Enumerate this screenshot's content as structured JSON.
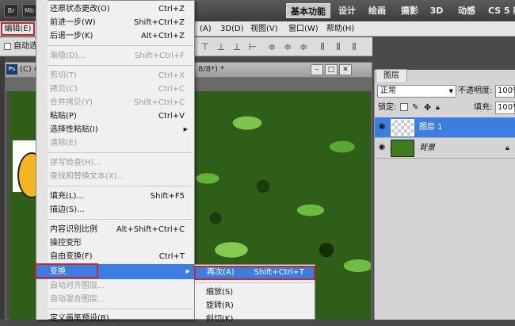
{
  "appbar": {
    "icons": [
      "Br",
      "Mb"
    ],
    "workspaces": [
      "基本功能",
      "设计",
      "绘画",
      "摄影",
      "3D",
      "动感",
      "CS 5 新"
    ]
  },
  "menubar": {
    "edit": "编辑(E)",
    "items_right": [
      "(A)",
      "3D(D)",
      "视图(V)",
      "窗口(W)",
      "帮助(H)"
    ]
  },
  "options": {
    "auto_select": "自动选"
  },
  "document": {
    "tab_icon": "Ps",
    "title_left": "(C) C",
    "title_right": "8/8*) *"
  },
  "edit_menu": {
    "items": [
      {
        "label": "还原状态更改(O)",
        "shortcut": "Ctrl+Z",
        "disabled": false
      },
      {
        "label": "前进一步(W)",
        "shortcut": "Shift+Ctrl+Z",
        "disabled": false
      },
      {
        "label": "后退一步(K)",
        "shortcut": "Alt+Ctrl+Z",
        "disabled": false
      },
      {
        "label": "渐隐(D)...",
        "shortcut": "Shift+Ctrl+F",
        "disabled": true
      },
      {
        "label": "剪切(T)",
        "shortcut": "Ctrl+X",
        "disabled": true
      },
      {
        "label": "拷贝(C)",
        "shortcut": "Ctrl+C",
        "disabled": true
      },
      {
        "label": "合并拷贝(Y)",
        "shortcut": "Shift+Ctrl+C",
        "disabled": true
      },
      {
        "label": "粘贴(P)",
        "shortcut": "Ctrl+V",
        "disabled": false
      },
      {
        "label": "选择性粘贴(I)",
        "shortcut": "",
        "disabled": false
      },
      {
        "label": "清除(E)",
        "shortcut": "",
        "disabled": true
      },
      {
        "label": "拼写检查(H)...",
        "shortcut": "",
        "disabled": true
      },
      {
        "label": "查找和替换文本(X)...",
        "shortcut": "",
        "disabled": true
      },
      {
        "label": "填充(L)...",
        "shortcut": "Shift+F5",
        "disabled": false
      },
      {
        "label": "描边(S)...",
        "shortcut": "",
        "disabled": false
      },
      {
        "label": "内容识别比例",
        "shortcut": "Alt+Shift+Ctrl+C",
        "disabled": false
      },
      {
        "label": "操控变形",
        "shortcut": "",
        "disabled": false
      },
      {
        "label": "自由变换(F)",
        "shortcut": "Ctrl+T",
        "disabled": false
      },
      {
        "label": "变换",
        "shortcut": "",
        "disabled": false
      },
      {
        "label": "自动对齐图层...",
        "shortcut": "",
        "disabled": true
      },
      {
        "label": "自动混合图层...",
        "shortcut": "",
        "disabled": true
      },
      {
        "label": "定义画笔预设(B)...",
        "shortcut": "",
        "disabled": false
      }
    ]
  },
  "transform_submenu": {
    "items": [
      {
        "label": "再次(A)",
        "shortcut": "Shift+Ctrl+T"
      },
      {
        "label": "缩放(S)",
        "shortcut": ""
      },
      {
        "label": "旋转(R)",
        "shortcut": ""
      },
      {
        "label": "斜切(K)",
        "shortcut": ""
      }
    ]
  },
  "layers": {
    "tab": "图层",
    "blend_mode": "正常",
    "opacity_label": "不透明度:",
    "opacity_value": "100%",
    "lock_label": "锁定:",
    "fill_label": "填充:",
    "fill_value": "100%",
    "rows": [
      {
        "name": "图层 1",
        "selected": true
      },
      {
        "name": "背景",
        "selected": false
      }
    ]
  },
  "colors": {
    "highlight": "#3b7de0",
    "annotation_red": "#d0232e"
  }
}
